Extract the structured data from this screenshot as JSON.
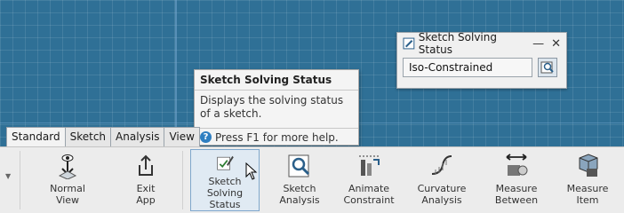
{
  "status_window": {
    "title": "Sketch Solving Status",
    "minimize": "—",
    "close": "✕",
    "value": "Iso-Constrained"
  },
  "tooltip": {
    "title": "Sketch Solving Status",
    "description": "Displays the solving status of a sketch.",
    "help": "Press F1 for more help.",
    "help_icon": "?"
  },
  "tabs": [
    "Standard",
    "Sketch",
    "Analysis",
    "View"
  ],
  "ribbon": {
    "collapse": "▼",
    "buttons": [
      {
        "line1": "Normal",
        "line2": "View"
      },
      {
        "line1": "Exit",
        "line2": "App"
      },
      {
        "line1": "Sketch",
        "line2": "Solving Status"
      },
      {
        "line1": "Sketch",
        "line2": "Analysis"
      },
      {
        "line1": "Animate",
        "line2": "Constraint"
      },
      {
        "line1": "Curvature",
        "line2": "Analysis"
      },
      {
        "line1": "Measure",
        "line2": "Between"
      },
      {
        "line1": "Measure",
        "line2": "Item"
      }
    ]
  },
  "colors": {
    "canvas": "#2f7096",
    "ribbon": "#ececec",
    "selected_border": "#7fa7cc"
  }
}
